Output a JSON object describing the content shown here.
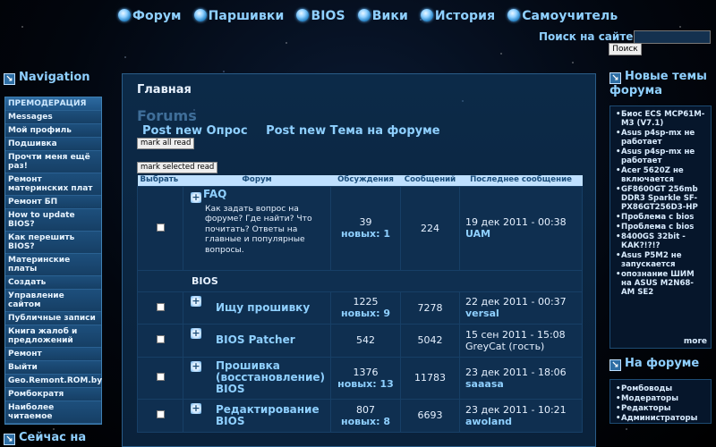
{
  "topnav": [
    {
      "label": "Форум"
    },
    {
      "label": "Паршивки"
    },
    {
      "label": "BIOS"
    },
    {
      "label": "Вики"
    },
    {
      "label": "История"
    },
    {
      "label": "Самоучитель"
    }
  ],
  "search": {
    "label": "Поиск на сайте:",
    "button": "Поиск",
    "value": ""
  },
  "left_panel": {
    "title": "Navigation",
    "items": [
      "ПРЕМОДЕРАЦИЯ",
      "Messages",
      "Мой профиль",
      "Подшивка",
      "Прочти меня ещё раз!",
      "Ремонт материнских плат",
      "Ремонт БП",
      "How to update BIOS?",
      "Как перешить BIOS?",
      "Материнские платы",
      "Создать",
      "Управление сайтом",
      "Публичные записи",
      "Книга жалоб и предложений",
      "Ремонт",
      "Выйти",
      "Geo.Remont.ROM.by",
      "Ромбократя",
      "Наиболее читаемое"
    ],
    "next_title": "Сейчас на"
  },
  "right_panel_new": {
    "title": "Новые темы форума",
    "items": [
      "Биос ECS MCP61M-M3 (V7.1)",
      "Asus p4sp-mx не работает",
      "Asus p4sp-mx не работает",
      "Acer 5620Z не включается",
      "GF8600GT 256mb DDR3 Sparkle SF-PX86GT256D3-HP",
      "Проблема с bios",
      "Проблема с bios",
      "8400GS 32bit - КАК?!?!?",
      "Asus P5M2 не запускается",
      "опознание ШИМ на ASUS M2N68-AM SE2"
    ],
    "more": "more"
  },
  "right_panel_forum": {
    "title": "На форуме",
    "items": [
      "Ромбоводы",
      "Модераторы",
      "Редакторы",
      "Администраторы"
    ]
  },
  "main": {
    "breadcrumb": "Главная",
    "title": "Forums",
    "actions": [
      "Post new Опрос",
      "Post new Тема на форуме"
    ],
    "mark_all": "mark all read",
    "mark_selected": "mark selected read",
    "columns": [
      "Выбрать",
      "Форум",
      "Обсуждения",
      "Сообщений",
      "Последнее сообщение"
    ],
    "faq": {
      "name": "FAQ",
      "desc": "Как задать вопрос на форуме? Где найти? Что почитать? Ответы на главные и популярные вопросы.",
      "topics": "39",
      "new": "новых: 1",
      "posts": "224",
      "last_date": "19 дек 2011 - 00:38",
      "last_user": "UAM"
    },
    "category": "BIOS",
    "forums": [
      {
        "name": "Ищу прошивку",
        "topics": "1225",
        "new": "новых: 9",
        "posts": "7278",
        "last_date": "22 дек 2011 - 00:37",
        "last_user": "versal",
        "plain": false
      },
      {
        "name": "BIOS Patcher",
        "topics": "542",
        "new": "",
        "posts": "5042",
        "last_date": "15 сен 2011 - 15:08",
        "last_user": "GreyCat (гость)",
        "plain": true
      },
      {
        "name": "Прошивка (восстановление) BIOS",
        "topics": "1376",
        "new": "новых: 13",
        "posts": "11783",
        "last_date": "23 дек 2011 - 18:06",
        "last_user": "saaasa",
        "plain": false
      },
      {
        "name": "Редактирование BIOS",
        "topics": "807",
        "new": "новых: 8",
        "posts": "6693",
        "last_date": "23 дек 2011 - 10:21",
        "last_user": "awoland",
        "plain": false
      }
    ]
  }
}
